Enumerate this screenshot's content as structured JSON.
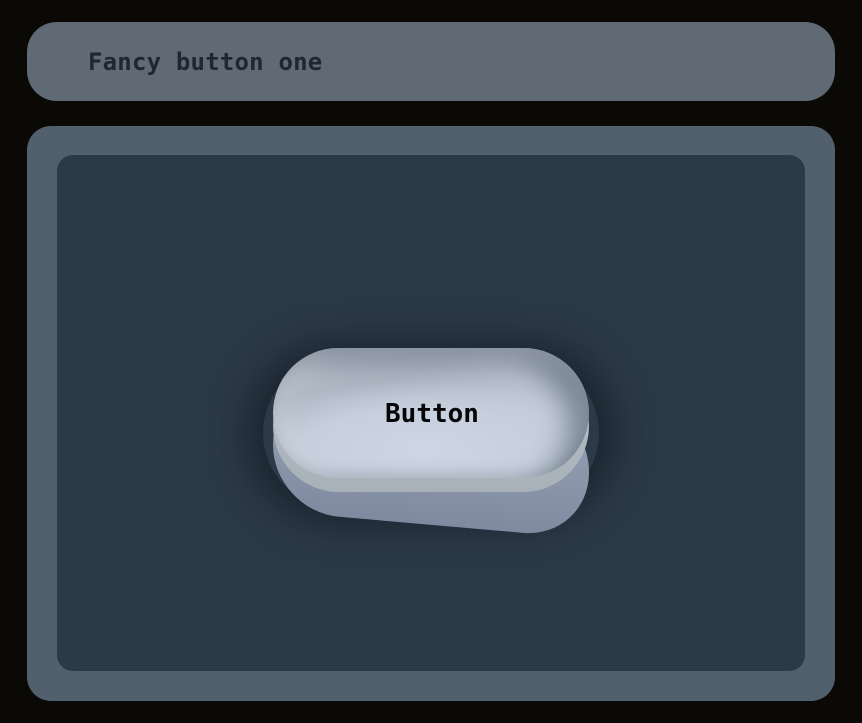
{
  "header": {
    "title": "Fancy button one"
  },
  "demo": {
    "button_label": "Button"
  },
  "colors": {
    "page_background": "#0a0905",
    "header_background": "#5f6a74",
    "panel_background": "#525f6c",
    "stage_background": "#2c3947",
    "button_face": "#c6cfdc",
    "button_base": "#8a95aa"
  }
}
